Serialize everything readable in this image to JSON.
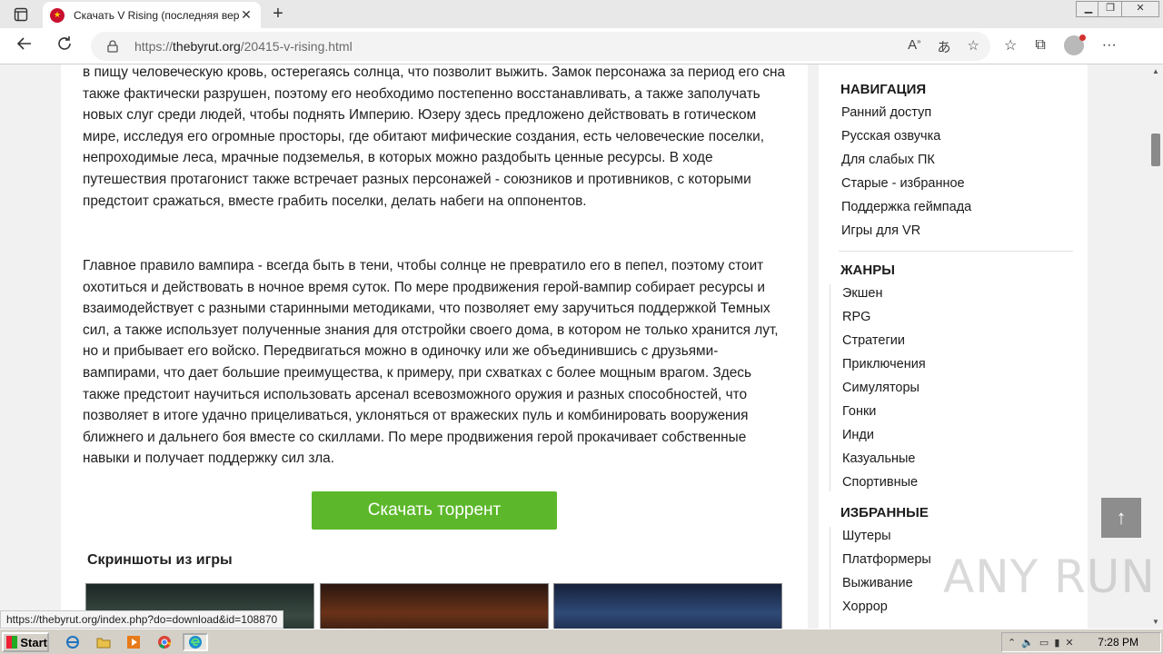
{
  "browser": {
    "tab_title": "Скачать V Rising (последняя вер",
    "tab_close": "✕",
    "new_tab": "+",
    "url_proto": "https://",
    "url_host": "thebyrut.org",
    "url_path": "/20415-v-rising.html",
    "window_controls": {
      "minimize": "▁",
      "maximize": "❐",
      "close": "✕"
    }
  },
  "article": {
    "paragraph1": "в пищу человеческую кровь, остерегаясь солнца, что позволит выжить. Замок персонажа за период его сна также фактически разрушен, поэтому его необходимо постепенно восстанавливать, а также заполучать новых слуг среди людей, чтобы поднять Империю. Юзеру здесь предложено действовать в готическом мире, исследуя его огромные просторы, где обитают мифические создания, есть человеческие поселки, непроходимые леса, мрачные подземелья, в которых можно раздобыть ценные ресурсы. В ходе путешествия протагонист также встречает разных персонажей - союзников и противников, с которыми предстоит сражаться, вместе грабить поселки, делать набеги на оппонентов.",
    "paragraph2": "Главное правило вампира - всегда быть в тени, чтобы солнце не превратило его в пепел, поэтому стоит охотиться и действовать в ночное время суток. По мере продвижения герой-вампир собирает ресурсы и взаимодействует с разными старинными методиками, что позволяет ему заручиться поддержкой Темных сил, а также использует полученные знания для отстройки своего дома, в котором не только хранится лут, но и прибывает его войско. Передвигаться можно в одиночку или же объединившись с друзьями-вампирами, что дает большие преимущества, к примеру, при схватках с более мощным врагом. Здесь также предстоит научиться использовать арсенал всевозможного оружия и разных способностей, что позволяет в итоге удачно прицеливаться, уклоняться от вражеских пуль и комбинировать вооружения ближнего и дальнего боя вместе со скиллами. По мере продвижения герой прокачивает собственные навыки и получает поддержку сил зла.",
    "download_button": "Скачать торрент",
    "screenshots_title": "Скриншоты из игры"
  },
  "sidebar": {
    "navigation_title": "НАВИГАЦИЯ",
    "navigation": [
      "Ранний доступ",
      "Русская озвучка",
      "Для слабых ПК",
      "Старые - избранное",
      "Поддержка геймпада",
      "Игры для VR"
    ],
    "genres_title": "ЖАНРЫ",
    "genres": [
      "Экшен",
      "RPG",
      "Стратегии",
      "Приключения",
      "Симуляторы",
      "Гонки",
      "Инди",
      "Казуальные",
      "Спортивные"
    ],
    "favorites_title": "ИЗБРАННЫЕ",
    "favorites": [
      "Шутеры",
      "Платформеры",
      "Выживание",
      "Хоррор"
    ]
  },
  "status_url": "https://thebyrut.org/index.php?do=download&id=108870",
  "watermark": "ANY RUN",
  "to_top": "↑",
  "taskbar": {
    "start_label": "Start",
    "clock": "7:28 PM"
  },
  "colors": {
    "download_green": "#5cb82a",
    "accent_red": "#c8102e"
  }
}
